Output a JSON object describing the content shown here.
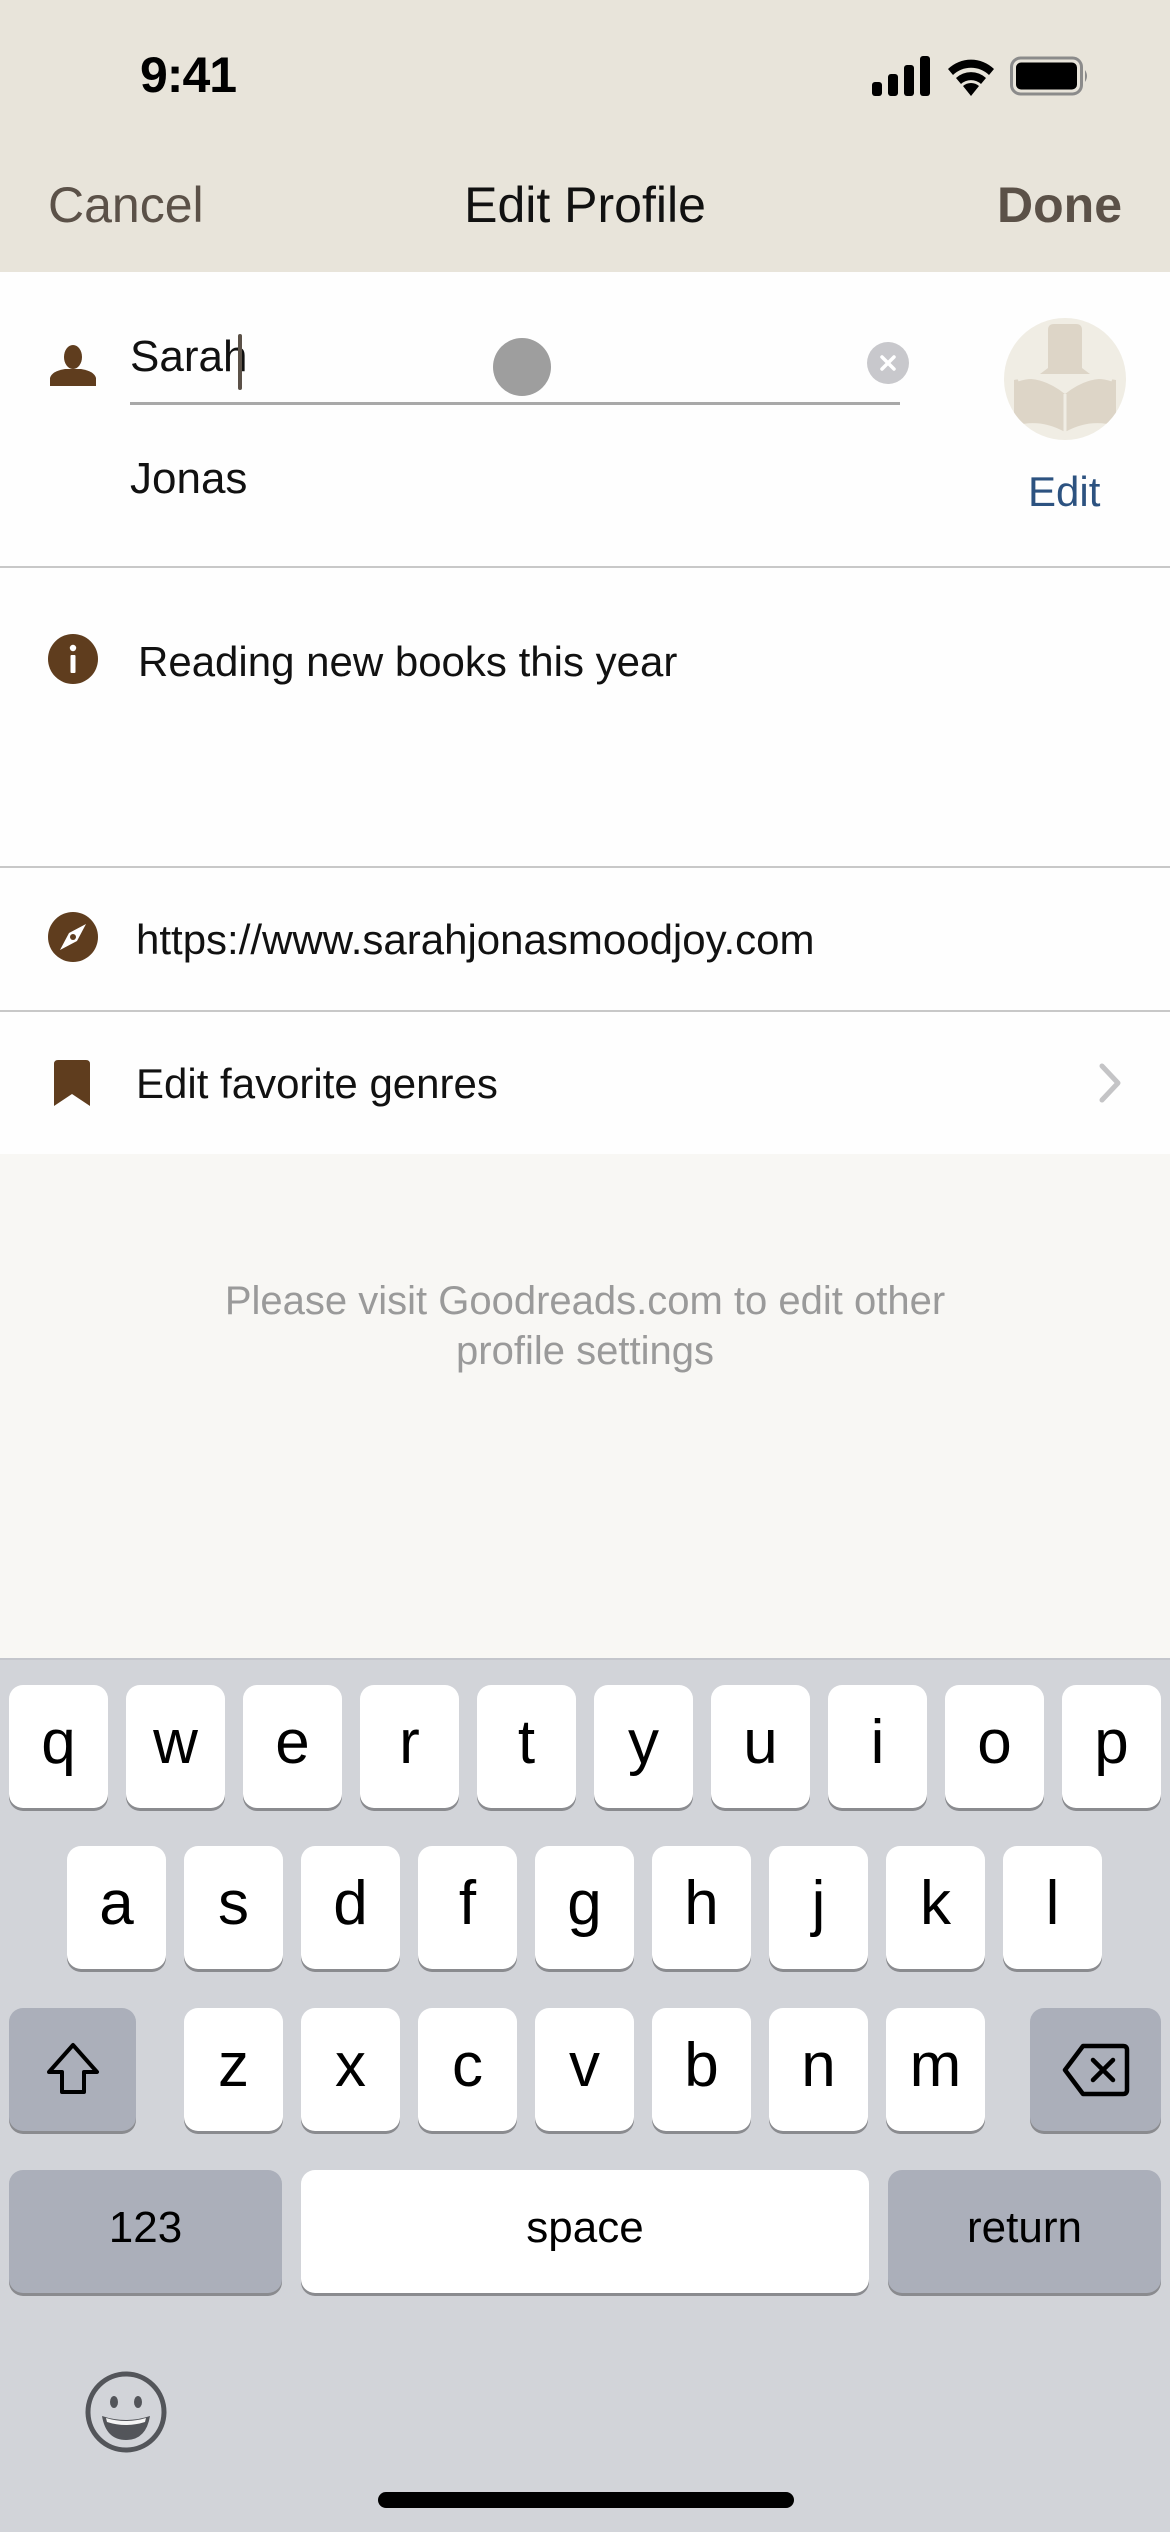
{
  "status_bar": {
    "time": "9:41",
    "icons": [
      "cellular-signal-icon",
      "wifi-icon",
      "battery-icon"
    ]
  },
  "nav": {
    "cancel_label": "Cancel",
    "title": "Edit Profile",
    "done_label": "Done"
  },
  "profile": {
    "first_name": "Sarah",
    "last_name": "Jonas",
    "avatar_edit_label": "Edit",
    "bio": "Reading new books this year",
    "website": "https://www.sarahjonasmoodjoy.com",
    "genres_label": "Edit favorite genres"
  },
  "notice": {
    "line1": "Please visit Goodreads.com to edit other",
    "line2": "profile settings"
  },
  "colors": {
    "header_bg": "#e8e4da",
    "icon_brown": "#5f3d1e",
    "nav_text": "#5b5148",
    "link_blue": "#2c5280",
    "keyboard_bg": "#d2d4d9"
  },
  "keyboard": {
    "row1": [
      "q",
      "w",
      "e",
      "r",
      "t",
      "y",
      "u",
      "i",
      "o",
      "p"
    ],
    "row2": [
      "a",
      "s",
      "d",
      "f",
      "g",
      "h",
      "j",
      "k",
      "l"
    ],
    "row3": [
      "z",
      "x",
      "c",
      "v",
      "b",
      "n",
      "m"
    ],
    "numbers_label": "123",
    "space_label": "space",
    "return_label": "return",
    "shift_icon": "shift-icon",
    "delete_icon": "delete-icon",
    "emoji_icon": "emoji-icon"
  }
}
